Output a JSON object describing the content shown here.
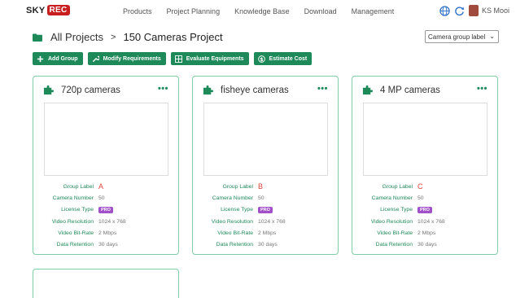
{
  "nav": {
    "logo_sky": "SKY",
    "logo_rec": "REC",
    "menu": [
      "Products",
      "Project Planning",
      "Knowledge Base",
      "Download",
      "Management"
    ],
    "user": "KS Mooi"
  },
  "breadcrumb": {
    "root": "All Projects",
    "separator": ">",
    "project": "150 Cameras Project"
  },
  "sort_select": {
    "value": "Camera group label"
  },
  "toolbar": {
    "add_group": "Add Group",
    "modify_requirements": "Modify Requirements",
    "evaluate_equipments": "Evaluate Equipments",
    "estimate_cost": "Estimate Cost"
  },
  "property_labels": {
    "group_label": "Group Label",
    "camera_number": "Camera Number",
    "license_type": "License Type",
    "video_resolution": "Video Resolution",
    "video_bitrate": "Video Bit-Rate",
    "data_retention": "Data Retention"
  },
  "cards": [
    {
      "title": "720p cameras",
      "more": "•••",
      "group_label": "A",
      "camera_number": "50",
      "license_type": "PRO",
      "video_resolution": "1024 x 768",
      "video_bitrate": "2 Mbps",
      "data_retention": "30 days"
    },
    {
      "title": "fisheye cameras",
      "more": "•••",
      "group_label": "B",
      "camera_number": "50",
      "license_type": "PRO",
      "video_resolution": "1024 x 768",
      "video_bitrate": "2 Mbps",
      "data_retention": "30 days"
    },
    {
      "title": "4 MP cameras",
      "more": "•••",
      "group_label": "C",
      "camera_number": "50",
      "license_type": "PRO",
      "video_resolution": "1024 x 768",
      "video_bitrate": "2 Mbps",
      "data_retention": "30 days"
    }
  ],
  "colors": {
    "brand_green": "#1e8a5a",
    "card_border": "#7fcfa6",
    "label_red": "#e0403a",
    "pro_purple": "#a050c8",
    "logo_red": "#c81e1e"
  },
  "icons": [
    "folder-icon",
    "globe-icon",
    "refresh-icon",
    "puzzle-icon",
    "more-icon",
    "plus-icon",
    "wrench-icon",
    "grid-icon",
    "dollar-icon",
    "chevron-down-icon"
  ]
}
